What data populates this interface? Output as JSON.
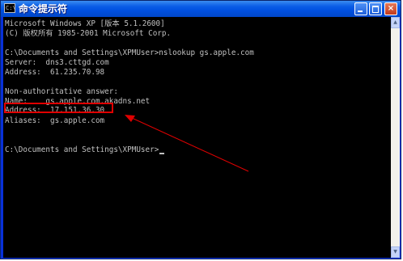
{
  "window": {
    "title": "命令提示符",
    "icon": "cmd-icon",
    "icon_glyph": "C:\\",
    "buttons": {
      "minimize": "minimize-icon",
      "maximize": "maximize-icon",
      "close": "close-icon",
      "close_glyph": "×"
    }
  },
  "console": {
    "lines": [
      "Microsoft Windows XP [版本 5.1.2600]",
      "(C) 版权所有 1985-2001 Microsoft Corp.",
      "",
      "C:\\Documents and Settings\\XPMUser>nslookup gs.apple.com",
      "Server:  dns3.cttgd.com",
      "Address:  61.235.70.98",
      "",
      "Non-authoritative answer:",
      "Name:    gs.apple.com.akadns.net",
      "Address:  17.151.36.30",
      "Aliases:  gs.apple.com",
      "",
      "",
      "C:\\Documents and Settings\\XPMUser>"
    ]
  },
  "scrollbar": {
    "up_glyph": "▲",
    "down_glyph": "▼"
  },
  "colors": {
    "console_bg": "#000000",
    "console_text": "#c0c0c0",
    "titlebar": "#0050e0",
    "annotation": "#e00000"
  }
}
